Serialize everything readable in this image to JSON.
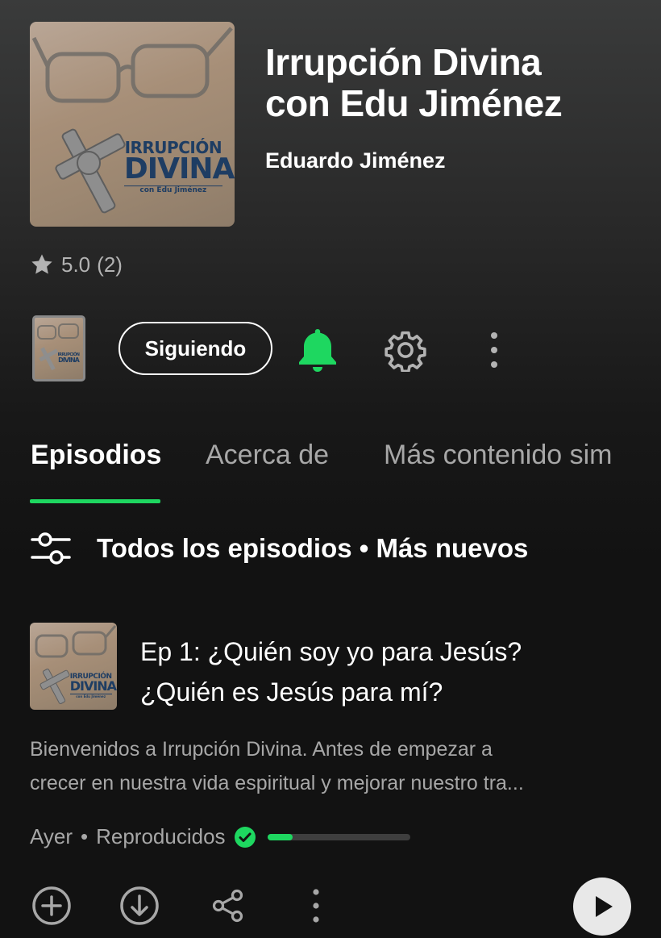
{
  "show": {
    "title_line1": "Irrupción Divina",
    "title_line2": "con Edu Jiménez",
    "author": "Eduardo Jiménez",
    "cover_text": {
      "line1": "IRRUPCIÓN",
      "line2": "DIVINA",
      "line3": "con Edu Jiménez"
    }
  },
  "rating": {
    "icon": "star-icon",
    "value": "5.0",
    "count": "(2)"
  },
  "actions": {
    "follow_label": "Siguiendo",
    "bell_icon": "bell-icon",
    "settings_icon": "gear-icon",
    "more_icon": "more-vertical-icon"
  },
  "tabs": [
    {
      "label": "Episodios",
      "active": true
    },
    {
      "label": "Acerca de",
      "active": false
    },
    {
      "label": "Más contenido sim",
      "active": false
    }
  ],
  "filter": {
    "icon": "filter-sliders-icon",
    "label": "Todos los episodios • Más nuevos"
  },
  "episode": {
    "title_line1": "Ep 1: ¿Quién soy yo para Jesús?",
    "title_line2": "¿Quién es Jesús para mí?",
    "description_line1": "Bienvenidos a Irrupción Divina. Antes de empezar a",
    "description_line2": "crecer en nuestra vida espiritual y mejorar nuestro tra...",
    "date": "Ayer",
    "separator": "•",
    "status": "Reproducidos",
    "progress_fraction": 0.18,
    "action_icons": [
      "add-circle-icon",
      "download-icon",
      "share-icon",
      "more-vertical-icon",
      "play-icon"
    ]
  },
  "colors": {
    "accent": "#1ed760",
    "background": "#121212",
    "muted_text": "#a7a7a7"
  }
}
